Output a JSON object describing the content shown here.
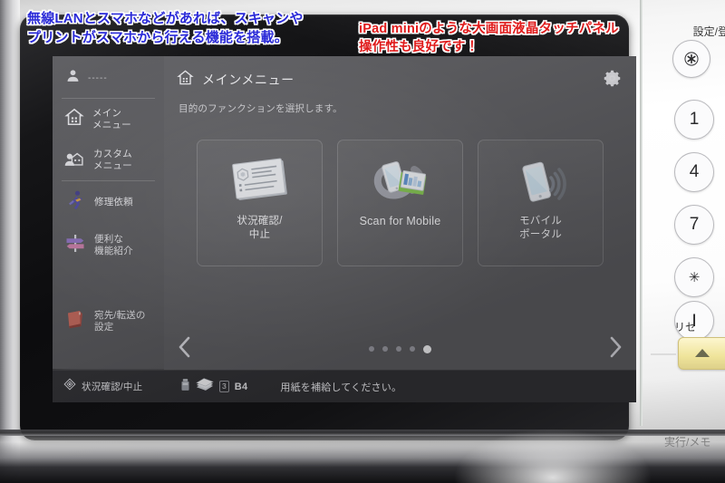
{
  "annotations": {
    "blue_line1": "無線LANとスマホなどがあれば、スキャンや",
    "blue_line2": "プリントがスマホから行える機能を搭載。",
    "red_line1": "iPad miniのような大画面液晶タッチパネル",
    "red_line2": "操作性も良好です！"
  },
  "sidebar": {
    "user": {
      "icon": "user-icon",
      "name": "-----"
    },
    "items": [
      {
        "icon": "home-icon",
        "line1": "メイン",
        "line2": "メニュー"
      },
      {
        "icon": "custom-menu-icon",
        "line1": "カスタム",
        "line2": "メニュー"
      },
      {
        "icon": "repair-icon",
        "line1": "修理依頼",
        "line2": ""
      },
      {
        "icon": "signpost-icon",
        "line1": "便利な",
        "line2": "機能紹介"
      },
      {
        "icon": "addressbook-icon",
        "line1": "宛先/転送の",
        "line2": "設定"
      }
    ]
  },
  "main": {
    "title": "メインメニュー",
    "title_icon": "home-icon",
    "subtitle": "目的のファンクションを選択します。",
    "settings_icon": "gear-icon",
    "cards": [
      {
        "label_line1": "状況確認/",
        "label_line2": "中止",
        "icon": "job-status-icon",
        "lang": "ja"
      },
      {
        "label_line1": "Scan for Mobile",
        "label_line2": "",
        "icon": "scan-for-mobile-icon",
        "lang": "en"
      },
      {
        "label_line1": "モバイル",
        "label_line2": "ポータル",
        "icon": "mobile-portal-icon",
        "lang": "ja"
      }
    ],
    "pager": {
      "prev_icon": "chevron-left-icon",
      "next_icon": "chevron-right-icon",
      "dot_count": 5,
      "active_dot": 5
    }
  },
  "statusbar": {
    "status_icon": "job-status-icon",
    "status_label": "状況確認/中止",
    "toner_icon": "toner-icon",
    "paper_icon": "paper-stack-icon",
    "tray_number": "3",
    "paper_size": "B4",
    "message": "用紙を補給してください。"
  },
  "control_panel": {
    "settings_label": "設定/登",
    "keys": [
      {
        "glyph": "✲",
        "name": "asterisk-key"
      },
      {
        "glyph": "1",
        "name": "key-1"
      },
      {
        "glyph": "4",
        "name": "key-4"
      },
      {
        "glyph": "7",
        "name": "key-7"
      },
      {
        "glyph": "✳",
        "name": "key-star"
      },
      {
        "glyph": "Ⅰ",
        "name": "key-id"
      }
    ],
    "reset_label": "リセ",
    "execute_label": "実行/メモ"
  },
  "colors": {
    "lcd_bg": "#5c5c60",
    "sidebar_bg": "#58585c",
    "statusbar_bg": "#323236",
    "anno_blue": "#2b2bd8",
    "anno_red": "#e01b1b",
    "yellow_key": "#efe49a"
  }
}
